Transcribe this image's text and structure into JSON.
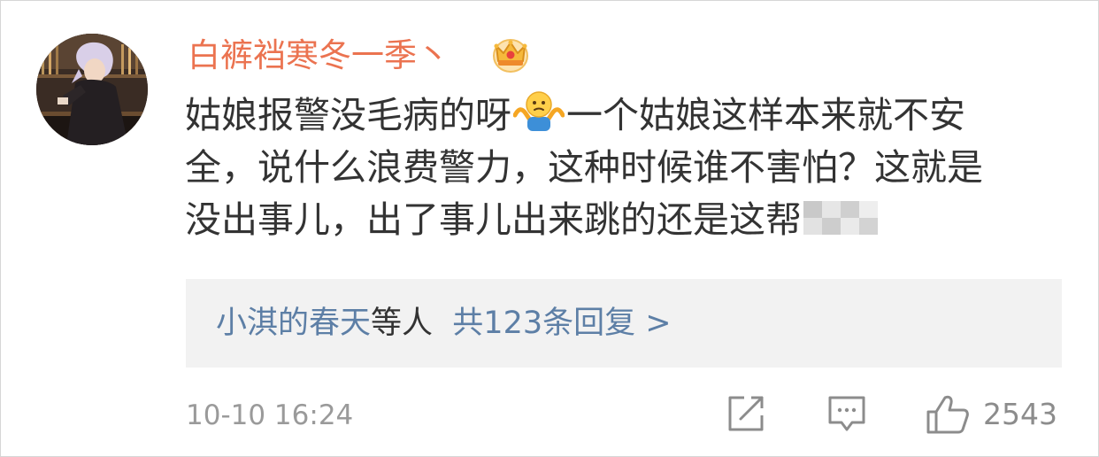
{
  "comment": {
    "username": "白裤裆寒冬一季丶",
    "badge_icon": "crown-icon",
    "text_lines": [
      {
        "before": "姑娘报警没毛病的呀",
        "emoji": "shrug-emoji",
        "after": "一个姑娘这样本来就不安"
      },
      {
        "text": "全，说什么浪费警力，这种时候谁不害怕？这就是"
      },
      {
        "text": "没出事儿，出了事儿出来跳的还是这帮"
      }
    ],
    "censored": true,
    "replies": {
      "first_names": "小淇的春天",
      "middle": "等人",
      "count_label": "共123条回复 >"
    },
    "timestamp": "10-10 16:24",
    "like_count": "2543"
  },
  "colors": {
    "username": "#eb7350",
    "link": "#5d7fa6",
    "body_text": "#333333",
    "meta_text": "#9a9a9a",
    "reply_bg": "#f2f2f2"
  }
}
